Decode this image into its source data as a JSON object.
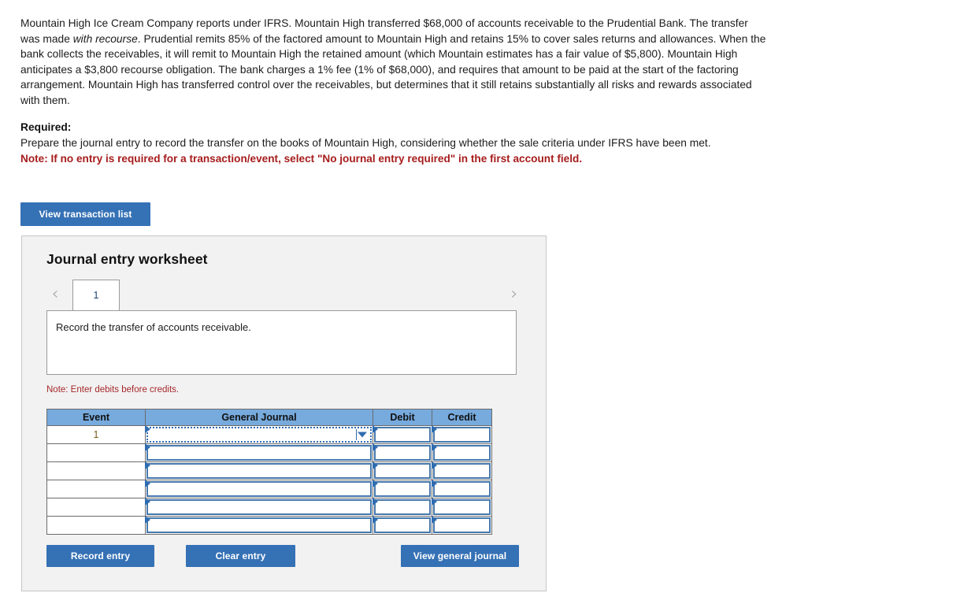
{
  "problem": {
    "paragraph_part1": "Mountain High Ice Cream Company reports under IFRS. Mountain High transferred $68,000 of accounts receivable to the Prudential Bank. The transfer was made ",
    "paragraph_italic": "with recourse",
    "paragraph_part2": ". Prudential remits 85% of the factored amount to Mountain High and retains 15% to cover sales returns and allowances. When the bank collects the receivables, it will remit to Mountain High the retained amount (which Mountain estimates has a fair value of $5,800). Mountain High anticipates a $3,800 recourse obligation. The bank charges a 1% fee (1% of $68,000), and requires that amount to be paid at the start of the factoring arrangement. Mountain High has transferred control over the receivables, but determines that it still retains substantially all risks and rewards associated with them."
  },
  "required": {
    "label": "Required:",
    "text": "Prepare the journal entry to record the transfer on the books of Mountain High, considering whether the sale criteria under IFRS have been met.",
    "note": "Note: If no entry is required for a transaction/event, select \"No journal entry required\" in the first account field."
  },
  "buttons": {
    "view_transaction_list": "View transaction list",
    "record_entry": "Record entry",
    "clear_entry": "Clear entry",
    "view_general_journal": "View general journal"
  },
  "worksheet": {
    "title": "Journal entry worksheet",
    "tabs": [
      {
        "label": "1",
        "active": true
      }
    ],
    "prev_icon": "chevron-left",
    "next_icon": "chevron-right",
    "description": "Record the transfer of accounts receivable.",
    "table_note": "Note: Enter debits before credits."
  },
  "table": {
    "columns": [
      "Event",
      "General Journal",
      "Debit",
      "Credit"
    ],
    "rows": [
      {
        "event": "1",
        "general_journal": "",
        "debit": "",
        "credit": ""
      },
      {
        "event": "",
        "general_journal": "",
        "debit": "",
        "credit": ""
      },
      {
        "event": "",
        "general_journal": "",
        "debit": "",
        "credit": ""
      },
      {
        "event": "",
        "general_journal": "",
        "debit": "",
        "credit": ""
      },
      {
        "event": "",
        "general_journal": "",
        "debit": "",
        "credit": ""
      },
      {
        "event": "",
        "general_journal": "",
        "debit": "",
        "credit": ""
      }
    ]
  },
  "colors": {
    "button_blue": "#3571b5",
    "table_header_blue": "#77aadd",
    "note_red": "#a6282a",
    "panel_gray": "#f2f2f2",
    "cell_border_blue": "#4679ad"
  }
}
